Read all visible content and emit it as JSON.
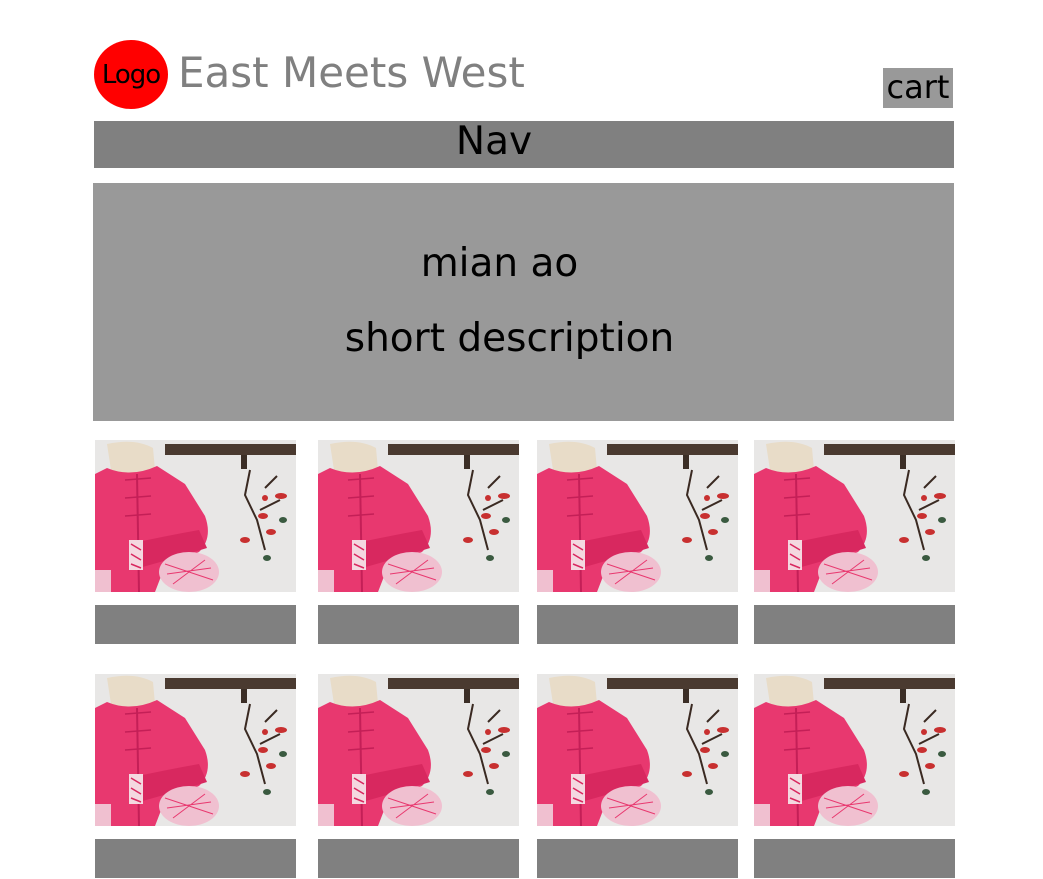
{
  "header": {
    "logo_label": "Logo",
    "site_title": "East Meets West",
    "cart_label": "cart"
  },
  "nav": {
    "label": "Nav"
  },
  "hero": {
    "title": "mian ao",
    "description": "short description"
  },
  "colors": {
    "logo": "#ff0000",
    "title_text": "#808080",
    "nav_bar": "#808080",
    "hero_bg": "#999999",
    "cart_bg": "#999999",
    "product_bar": "#808080",
    "jacket": "#e8386f"
  },
  "products": [
    {
      "image": "pink-jacket-photo"
    },
    {
      "image": "pink-jacket-photo"
    },
    {
      "image": "pink-jacket-photo"
    },
    {
      "image": "pink-jacket-photo"
    },
    {
      "image": "pink-jacket-photo"
    },
    {
      "image": "pink-jacket-photo"
    },
    {
      "image": "pink-jacket-photo"
    },
    {
      "image": "pink-jacket-photo"
    }
  ]
}
